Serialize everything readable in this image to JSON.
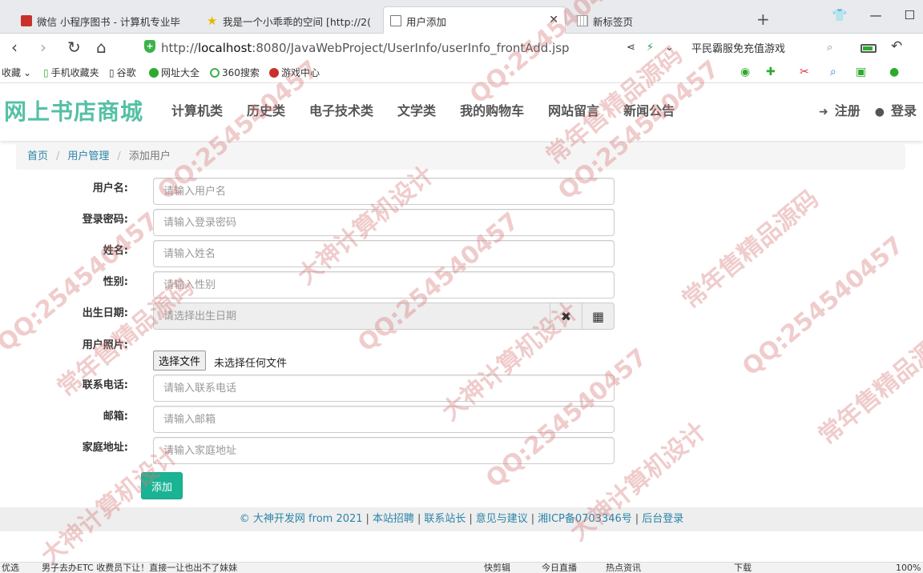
{
  "browser": {
    "tabs": [
      {
        "title": "微信 小程序图书 - 计算机专业毕",
        "active": false
      },
      {
        "title": "我是一个小乖乖的空间 [http://2(",
        "active": false
      },
      {
        "title": "用户添加",
        "active": true
      },
      {
        "title": "新标签页",
        "active": false
      }
    ],
    "url_prefix": "http://",
    "url_host": "localhost",
    "url_rest": ":8080/JavaWebProject/UserInfo/userInfo_frontAdd.jsp",
    "promo_text": "平民霸服免充值游戏"
  },
  "bookmarks": [
    "收藏",
    "手机收藏夹",
    "谷歌",
    "网址大全",
    "360搜索",
    "游戏中心"
  ],
  "site": {
    "brand": "网上书店商城",
    "menu": [
      "计算机类",
      "历史类",
      "电子技术类",
      "文学类",
      "我的购物车",
      "网站留言",
      "新闻公告"
    ],
    "register": "注册",
    "login": "登录"
  },
  "breadcrumb": {
    "home": "首页",
    "section": "用户管理",
    "current": "添加用户"
  },
  "form": {
    "username": {
      "label": "用户名:",
      "placeholder": "请输入用户名"
    },
    "password": {
      "label": "登录密码:",
      "placeholder": "请输入登录密码"
    },
    "name": {
      "label": "姓名:",
      "placeholder": "请输入姓名"
    },
    "gender": {
      "label": "性别:",
      "placeholder": "请输入性别"
    },
    "birthday": {
      "label": "出生日期:",
      "placeholder": "请选择出生日期"
    },
    "photo": {
      "label": "用户照片:",
      "button": "选择文件",
      "status": "未选择任何文件"
    },
    "phone": {
      "label": "联系电话:",
      "placeholder": "请输入联系电话"
    },
    "email": {
      "label": "邮箱:",
      "placeholder": "请输入邮箱"
    },
    "address": {
      "label": "家庭地址:",
      "placeholder": "请输入家庭地址"
    },
    "submit": "添加"
  },
  "footer": {
    "copyright": "© 大神开发网 from 2021",
    "links": [
      "本站招聘",
      "联系站长",
      "意见与建议",
      "湘ICP备0703346号",
      "后台登录"
    ]
  },
  "statusbar": {
    "left": "优选",
    "news": "男子去办ETC 收费员下让！直接一让也出不了妹妹",
    "items": [
      "快剪辑",
      "今日直播",
      "热点资讯",
      "下载"
    ],
    "zoom": "100%"
  },
  "watermarks": [
    "QQ:254540457",
    "大神计算机设计",
    "常年售精品源码"
  ],
  "colors": {
    "brand": "#55c0a6",
    "link": "#2a84a8",
    "button": "#1ab394",
    "footer_bg": "#eeeeee"
  }
}
